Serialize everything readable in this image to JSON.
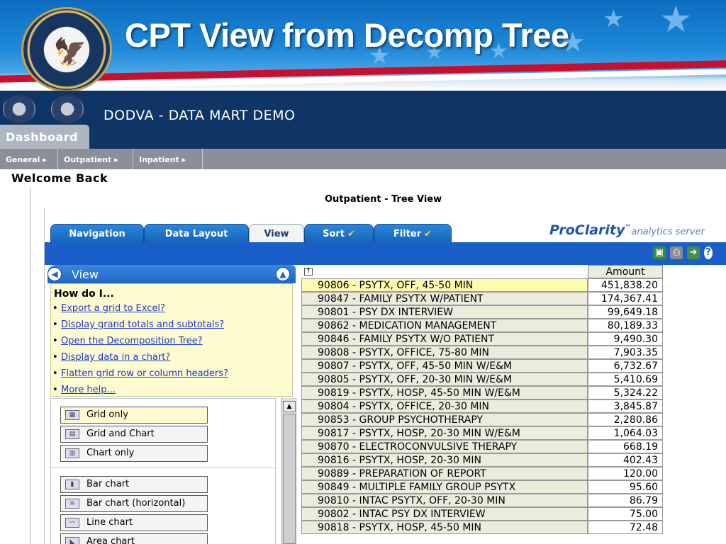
{
  "slide": {
    "title": "CPT View from Decomp Tree"
  },
  "app": {
    "name": "DODVA - DATA MART DEMO",
    "dashboard_tab": "Dashboard",
    "menu": [
      "General",
      "Outpatient",
      "Inpatient"
    ],
    "welcome": "Welcome Back",
    "report_title": "Outpatient - Tree View"
  },
  "proclarity": {
    "tabs": [
      "Navigation",
      "Data Layout",
      "View",
      "Sort",
      "Filter"
    ],
    "active_tab": "View",
    "brand": "ProClarity",
    "brand_tm": "™",
    "brand_sub": "analytics server",
    "toolbar_icons": [
      "save-icon",
      "print-icon",
      "export-icon",
      "help-icon"
    ]
  },
  "view_panel": {
    "title": "View",
    "howto_title": "How do I...",
    "links": [
      "Export a grid to Excel?",
      "Display grand totals and subtotals?",
      "Open the Decomposition Tree?",
      "Display data in a chart?",
      "Flatten grid row or column headers?",
      "More help..."
    ],
    "layout_options": [
      "Grid only",
      "Grid and Chart",
      "Chart only"
    ],
    "chart_options": [
      "Bar chart",
      "Bar chart (horizontal)",
      "Line chart",
      "Area chart"
    ]
  },
  "grid": {
    "column": "Amount",
    "rows": [
      {
        "name": "90806 - PSYTX, OFF, 45-50 MIN",
        "amount": "451,838.20"
      },
      {
        "name": "90847 - FAMILY PSYTX W/PATIENT",
        "amount": "174,367.41"
      },
      {
        "name": "90801 - PSY DX INTERVIEW",
        "amount": "99,649.18"
      },
      {
        "name": "90862 - MEDICATION MANAGEMENT",
        "amount": "80,189.33"
      },
      {
        "name": "90846 - FAMILY PSYTX W/O PATIENT",
        "amount": "9,490.30"
      },
      {
        "name": "90808 - PSYTX, OFFICE, 75-80 MIN",
        "amount": "7,903.35"
      },
      {
        "name": "90807 - PSYTX, OFF, 45-50 MIN W/E&M",
        "amount": "6,732.67"
      },
      {
        "name": "90805 - PSYTX, OFF, 20-30 MIN W/E&M",
        "amount": "5,410.69"
      },
      {
        "name": "90819 - PSYTX, HOSP, 45-50 MIN W/E&M",
        "amount": "5,324.22"
      },
      {
        "name": "90804 - PSYTX, OFFICE, 20-30 MIN",
        "amount": "3,845.87"
      },
      {
        "name": "90853 - GROUP PSYCHOTHERAPY",
        "amount": "2,280.86"
      },
      {
        "name": "90817 - PSYTX, HOSP, 20-30 MIN W/E&M",
        "amount": "1,064.03"
      },
      {
        "name": "90870 - ELECTROCONVULSIVE THERAPY",
        "amount": "668.19"
      },
      {
        "name": "90816 - PSYTX, HOSP, 20-30 MIN",
        "amount": "402.43"
      },
      {
        "name": "90889 - PREPARATION OF REPORT",
        "amount": "120.00"
      },
      {
        "name": "90849 - MULTIPLE FAMILY GROUP PSYTX",
        "amount": "95.60"
      },
      {
        "name": "90810 - INTAC PSYTX, OFF, 20-30 MIN",
        "amount": "86.79"
      },
      {
        "name": "90802 - INTAC PSY DX INTERVIEW",
        "amount": "75.00"
      },
      {
        "name": "90818 - PSYTX, HOSP, 45-50 MIN",
        "amount": "72.48"
      }
    ]
  }
}
